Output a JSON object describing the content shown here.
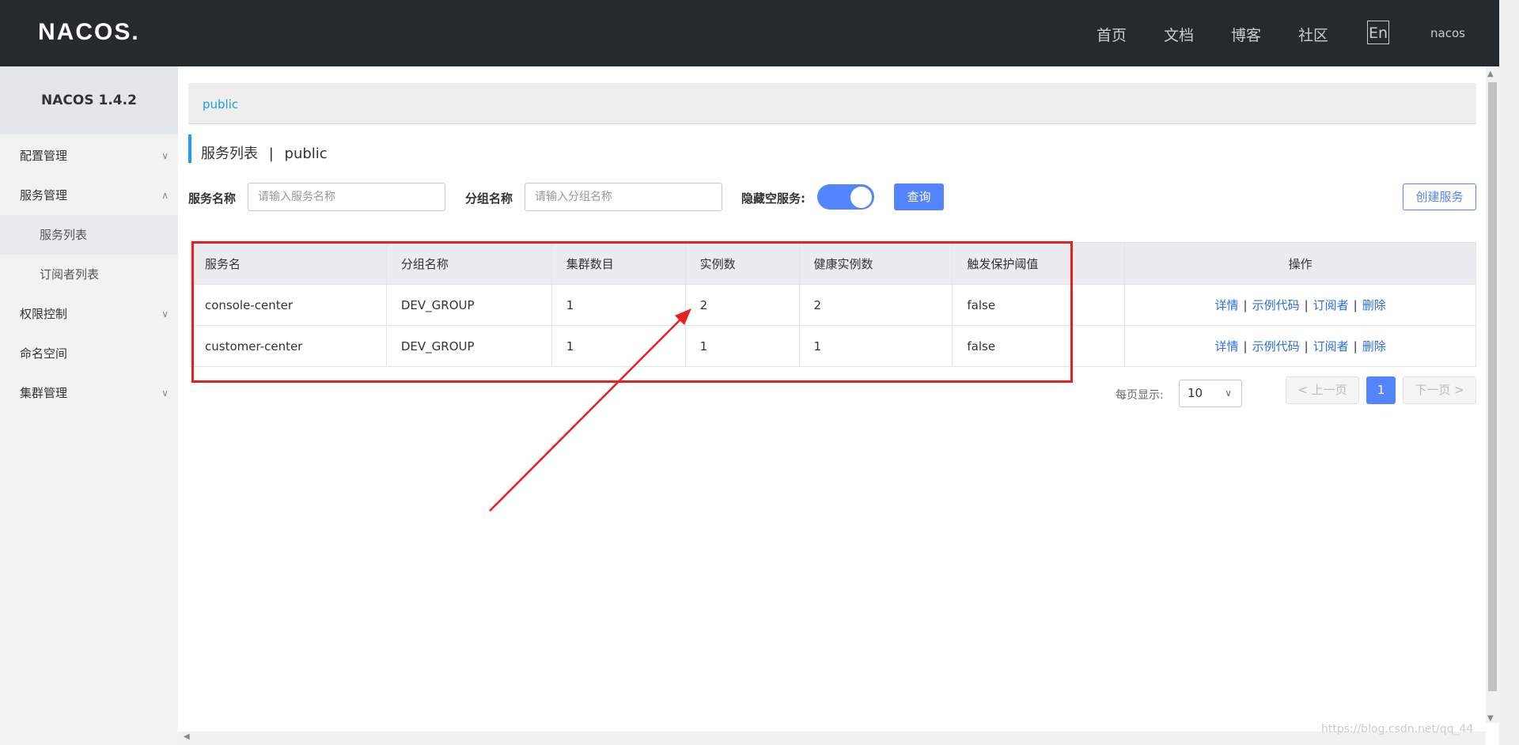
{
  "header": {
    "logo": "NACOS.",
    "nav": [
      "首页",
      "文档",
      "博客",
      "社区"
    ],
    "lang": "En",
    "user": "nacos"
  },
  "sidebar": {
    "title": "NACOS 1.4.2",
    "items": [
      {
        "label": "配置管理",
        "chevron": "chevron-down"
      },
      {
        "label": "服务管理",
        "chevron": "chevron-up"
      },
      {
        "label": "服务列表",
        "sub": true,
        "active": true
      },
      {
        "label": "订阅者列表",
        "sub": true
      },
      {
        "label": "权限控制",
        "chevron": "chevron-down"
      },
      {
        "label": "命名空间"
      },
      {
        "label": "集群管理",
        "chevron": "chevron-down"
      }
    ]
  },
  "main": {
    "breadcrumb": "public",
    "title_main": "服务列表",
    "title_sep": "|",
    "title_ns": "public",
    "form": {
      "service_label": "服务名称",
      "service_placeholder": "请输入服务名称",
      "group_label": "分组名称",
      "group_placeholder": "请输入分组名称",
      "hide_empty_label": "隐藏空服务:",
      "hide_empty_on": true,
      "query_label": "查询",
      "create_label": "创建服务"
    },
    "table": {
      "headers": [
        "服务名",
        "分组名称",
        "集群数目",
        "实例数",
        "健康实例数",
        "触发保护阈值",
        "操作"
      ],
      "rows": [
        [
          "console-center",
          "DEV_GROUP",
          "1",
          "2",
          "2",
          "false"
        ],
        [
          "customer-center",
          "DEV_GROUP",
          "1",
          "1",
          "1",
          "false"
        ]
      ],
      "ops": [
        "详情",
        "示例代码",
        "订阅者",
        "删除"
      ]
    },
    "pagination": {
      "page_size_label": "每页显示:",
      "page_size": "10",
      "prev": "上一页",
      "current": "1",
      "next": "下一页"
    }
  },
  "watermark": "https://blog.csdn.net/qq_44"
}
